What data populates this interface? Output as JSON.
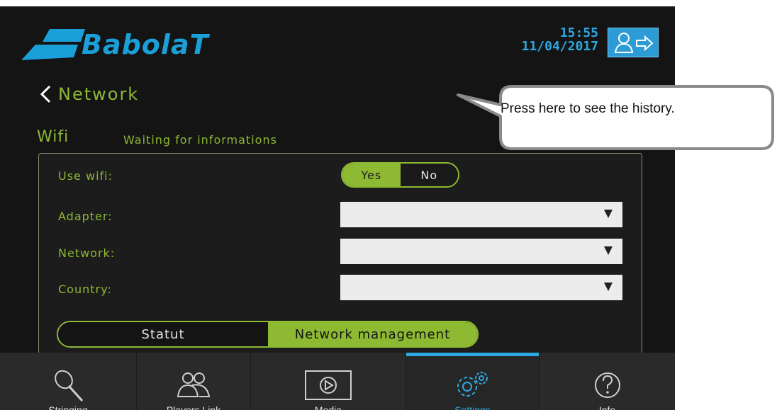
{
  "header": {
    "brand": "BabolaT",
    "time": "15:55",
    "date": "11/04/2017",
    "logout_icon": "user-logout-icon"
  },
  "page": {
    "title": "Network",
    "back_icon": "chevron-left-icon"
  },
  "wifi": {
    "label": "Wifi",
    "status": "Waiting for informations",
    "use_wifi_label": "Use wifi:",
    "toggle": {
      "yes": "Yes",
      "no": "No",
      "selected": "Yes"
    },
    "adapter_label": "Adapter:",
    "adapter_value": "",
    "network_label": "Network:",
    "network_value": "",
    "country_label": "Country:",
    "country_value": ""
  },
  "segment": {
    "statut": "Statut",
    "management": "Network management",
    "selected": "Network management"
  },
  "nav": {
    "items": [
      {
        "label": "Stringing",
        "icon": "racket-icon"
      },
      {
        "label": "Players Link",
        "icon": "players-icon"
      },
      {
        "label": "Media",
        "icon": "play-icon"
      },
      {
        "label": "Settings",
        "icon": "gears-icon",
        "active": true
      },
      {
        "label": "Info",
        "icon": "question-icon"
      }
    ]
  },
  "callout": {
    "text": "Press here to see the history."
  },
  "colors": {
    "accent_green": "#8db933",
    "accent_blue": "#2ea8e0",
    "background": "#141414"
  }
}
